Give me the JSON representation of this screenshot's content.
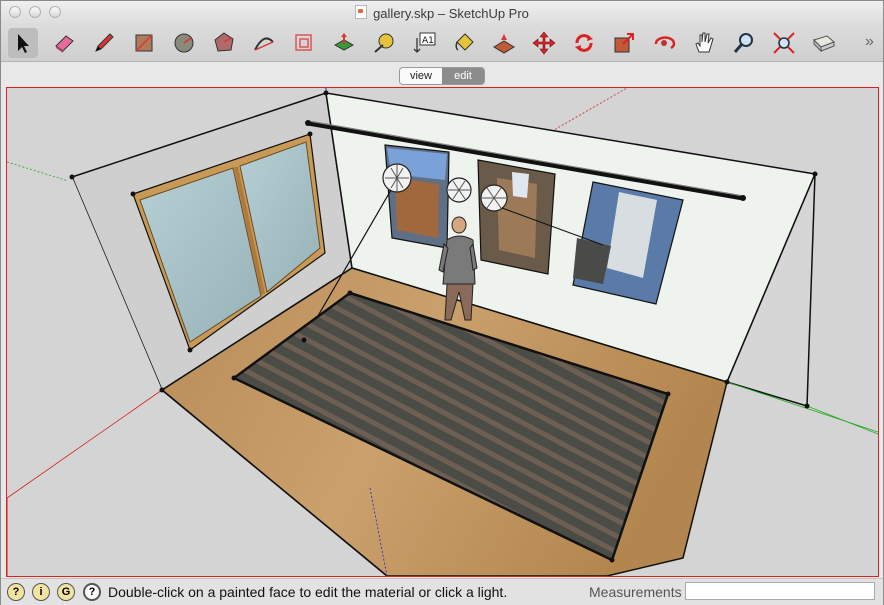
{
  "window": {
    "title": "gallery.skp – SketchUp Pro"
  },
  "toolbar": {
    "tools": [
      {
        "name": "select",
        "icon": "arrow-cursor-icon"
      },
      {
        "name": "eraser",
        "icon": "eraser-icon"
      },
      {
        "name": "pencil",
        "icon": "pencil-icon"
      },
      {
        "name": "rectangle",
        "icon": "rectangle-icon"
      },
      {
        "name": "circle",
        "icon": "circle-icon"
      },
      {
        "name": "polygon",
        "icon": "polygon-icon"
      },
      {
        "name": "arc",
        "icon": "arc-icon"
      },
      {
        "name": "offset",
        "icon": "offset-icon"
      },
      {
        "name": "push-pull",
        "icon": "push-pull-icon"
      },
      {
        "name": "tape-measure",
        "icon": "tape-measure-icon"
      },
      {
        "name": "text",
        "icon": "text-icon",
        "label": "A1"
      },
      {
        "name": "paint-bucket",
        "icon": "paint-bucket-icon"
      },
      {
        "name": "follow-me",
        "icon": "follow-me-icon"
      },
      {
        "name": "move",
        "icon": "move-icon"
      },
      {
        "name": "rotate",
        "icon": "rotate-icon"
      },
      {
        "name": "scale",
        "icon": "scale-icon"
      },
      {
        "name": "orbit",
        "icon": "orbit-icon"
      },
      {
        "name": "pan",
        "icon": "pan-hand-icon"
      },
      {
        "name": "zoom",
        "icon": "zoom-icon"
      },
      {
        "name": "zoom-extents",
        "icon": "zoom-extents-icon"
      },
      {
        "name": "warehouse",
        "icon": "warehouse-icon"
      }
    ],
    "overflow": "»"
  },
  "mode_switch": {
    "view_label": "view",
    "edit_label": "edit",
    "selected": "edit"
  },
  "status": {
    "message": "Double-click on a painted face to edit the material or click a light.",
    "measurements_label": "Measurements",
    "measurements_value": "",
    "help_icon": "?"
  },
  "colors": {
    "viewport_border": "#e0201f",
    "axis_red": "#d02020",
    "axis_green": "#1faa1f",
    "axis_blue": "#2020d0"
  }
}
